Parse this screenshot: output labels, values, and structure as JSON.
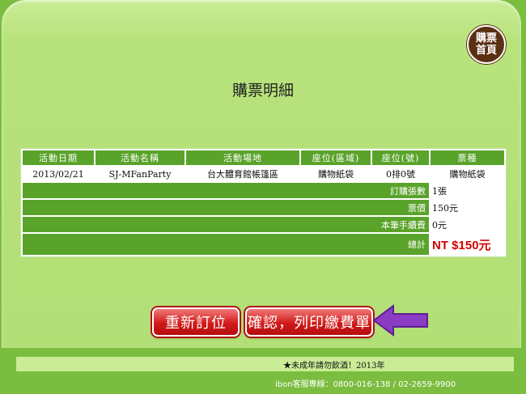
{
  "home": {
    "label": "購票\n首頁"
  },
  "page_title": "購票明細",
  "table": {
    "headers": [
      "活動日期",
      "活動名稱",
      "活動場地",
      "座位(區域)",
      "座位(號)",
      "票種"
    ],
    "row": [
      "2013/02/21",
      "SJ-MFanParty",
      "台大體育館帳篷區",
      "購物紙袋",
      "0排0號",
      "購物紙袋"
    ]
  },
  "summary": {
    "ticket_count_label": "訂購張數",
    "ticket_count": "1張",
    "price_label": "票價",
    "price": "150元",
    "fee_label": "本筆手續費",
    "fee": "0元",
    "total_label": "總計",
    "total": "NT $150元"
  },
  "buttons": {
    "rebook": "重新訂位",
    "confirm": "確認，列印繳費單"
  },
  "footer": {
    "marquee": "★未成年請勿飲酒！2013年",
    "hotline": "ibon客服專線：0800-016-138 / 02-2659-9900"
  },
  "colors": {
    "header_green": "#5aa32a",
    "total_red": "#d40000",
    "button_red": "#d11a1a",
    "arrow_purple": "#8b3cc4"
  }
}
